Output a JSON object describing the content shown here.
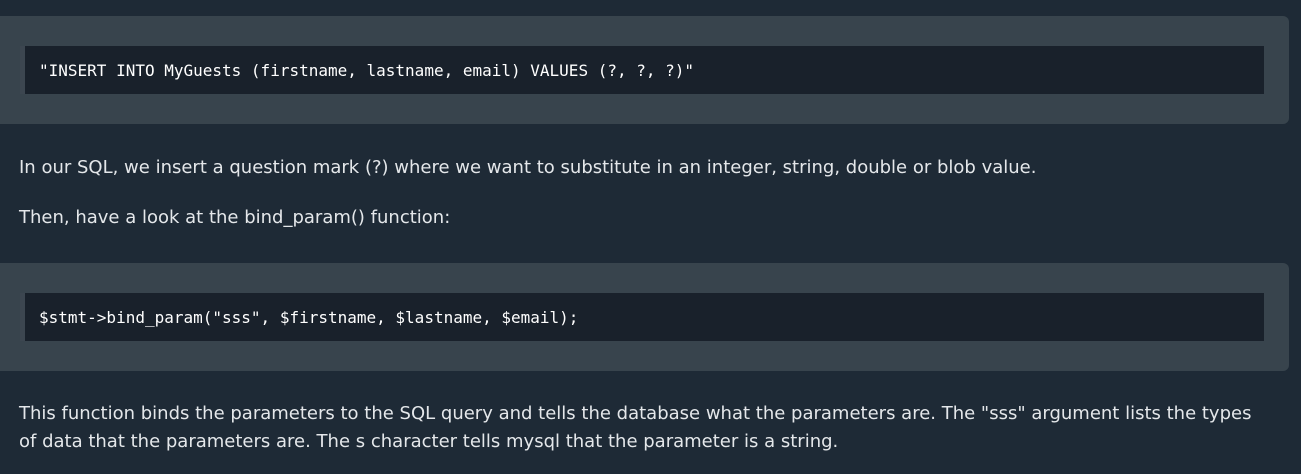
{
  "examples": [
    {
      "code": "\"INSERT INTO MyGuests (firstname, lastname, email) VALUES (?, ?, ?)\""
    },
    {
      "code": "$stmt->bind_param(\"sss\", $firstname, $lastname, $email);"
    }
  ],
  "paragraphs": [
    "In our SQL, we insert a question mark (?) where we want to substitute in an integer, string, double or blob value.",
    "Then, have a look at the bind_param() function:",
    "This function binds the parameters to the SQL query and tells the database what the parameters are. The \"sss\" argument lists the types of data that the parameters are. The s character tells mysql that the parameter is a string."
  ],
  "colors": {
    "page_background": "#1e2a36",
    "panel_background": "#38444d",
    "code_background": "#19212b",
    "text": "#e4e7ea"
  }
}
